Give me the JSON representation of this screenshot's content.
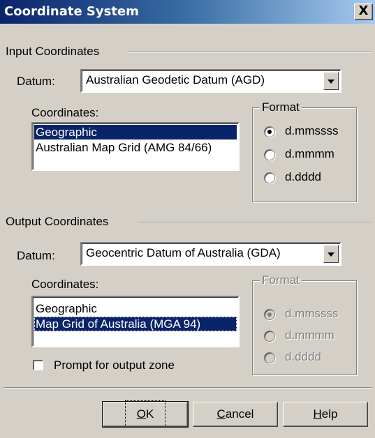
{
  "window": {
    "title": "Coordinate System",
    "close_label": "X"
  },
  "input": {
    "section_label": "Input Coordinates",
    "datum_label": "Datum:",
    "datum_value": "Australian Geodetic Datum (AGD)",
    "coordinates_label": "Coordinates:",
    "coordinates": [
      {
        "label": "Geographic",
        "selected": true
      },
      {
        "label": "Australian Map Grid (AMG 84/66)",
        "selected": false
      }
    ],
    "format_label": "Format",
    "format_options": [
      {
        "label": "d.mmssss",
        "checked": true
      },
      {
        "label": "d.mmmm",
        "checked": false
      },
      {
        "label": "d.dddd",
        "checked": false
      }
    ]
  },
  "output": {
    "section_label": "Output Coordinates",
    "datum_label": "Datum:",
    "datum_value": "Geocentric Datum of Australia (GDA)",
    "coordinates_label": "Coordinates:",
    "coordinates": [
      {
        "label": "Geographic",
        "selected": false
      },
      {
        "label": "Map Grid of Australia (MGA 94)",
        "selected": true
      }
    ],
    "format_label": "Format",
    "format_enabled": false,
    "format_options": [
      {
        "label": "d.mmssss",
        "checked": true
      },
      {
        "label": "d.mmmm",
        "checked": false
      },
      {
        "label": "d.dddd",
        "checked": false
      }
    ],
    "prompt_label": "Prompt for output zone",
    "prompt_checked": false
  },
  "buttons": {
    "ok": "OK",
    "cancel": "Cancel",
    "help": "Help"
  }
}
